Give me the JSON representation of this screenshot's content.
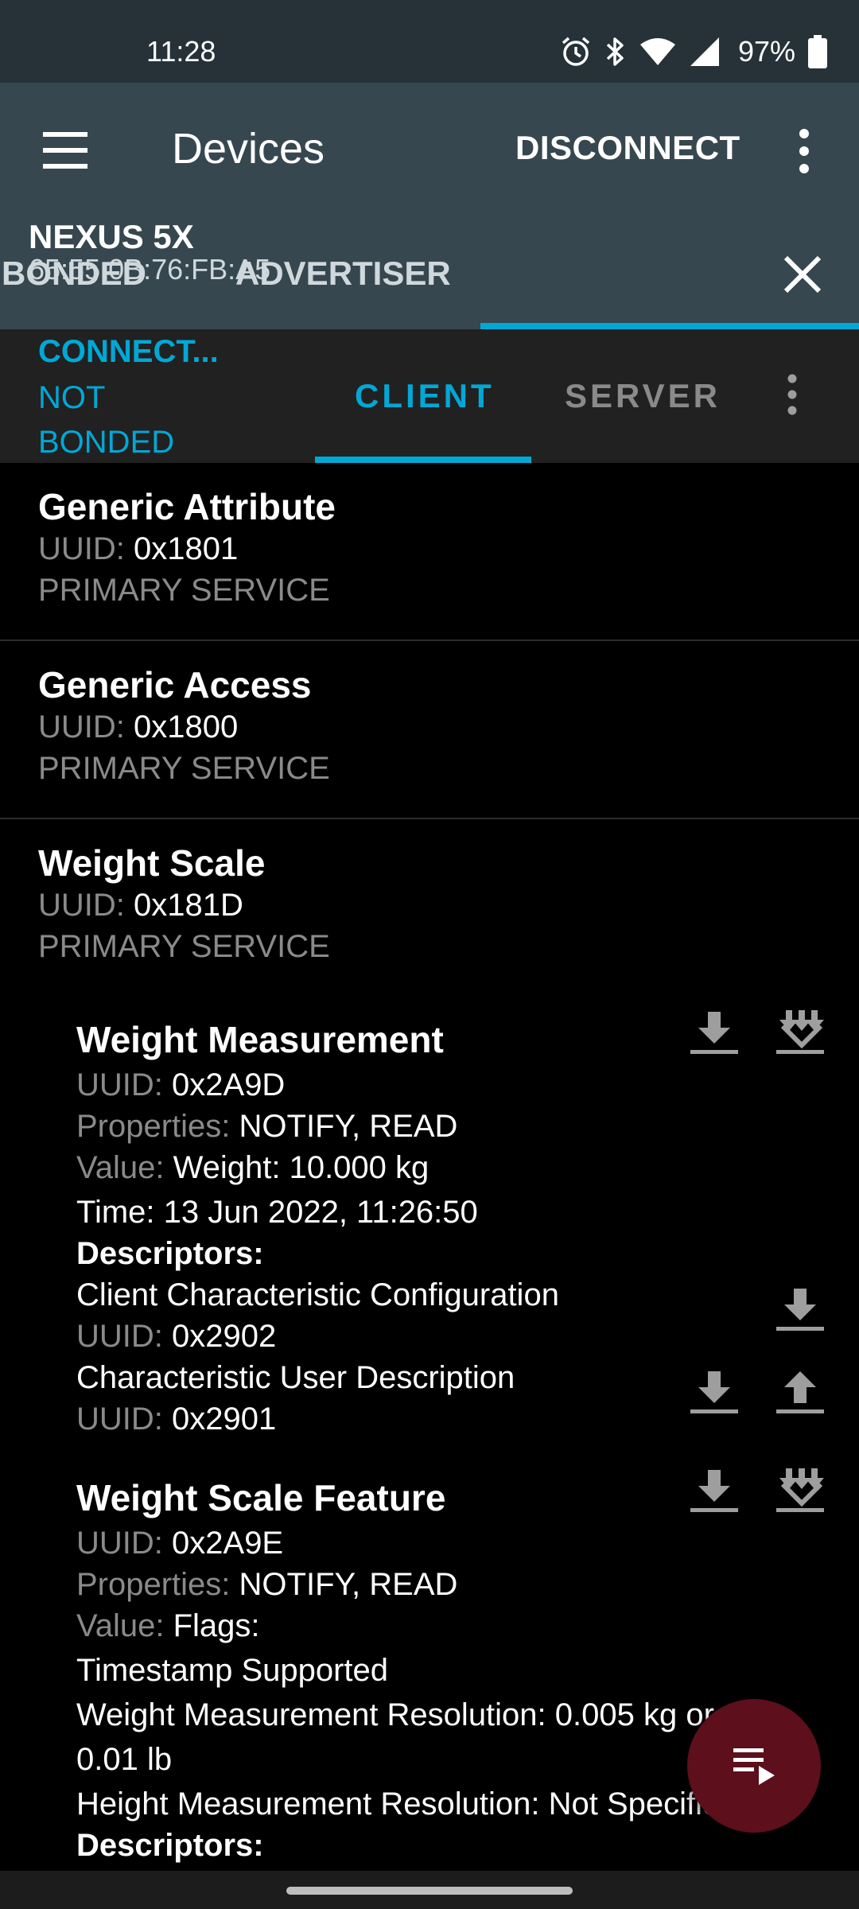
{
  "status_bar": {
    "time": "11:28",
    "battery": "97%",
    "icons": [
      "alarm-icon",
      "bluetooth-icon",
      "wifi-icon",
      "signal-icon",
      "battery-icon"
    ]
  },
  "app_bar": {
    "title": "Devices",
    "disconnect_label": "DISCONNECT"
  },
  "device_tabs": {
    "bonded": "BONDED",
    "advertiser": "ADVERTISER",
    "device_name": "NEXUS 5X",
    "device_address": "65:55:0B:76:FB:A5"
  },
  "connection": {
    "state": "CONNECT...",
    "bond_state": "NOT BONDED",
    "tab_client": "CLIENT",
    "tab_server": "SERVER"
  },
  "labels": {
    "uuid": "UUID:",
    "properties": "Properties:",
    "value": "Value:",
    "descriptors": "Descriptors:"
  },
  "services": [
    {
      "name": "Generic Attribute",
      "uuid": "0x1801",
      "type": "PRIMARY SERVICE"
    },
    {
      "name": "Generic Access",
      "uuid": "0x1800",
      "type": "PRIMARY SERVICE"
    },
    {
      "name": "Weight Scale",
      "uuid": "0x181D",
      "type": "PRIMARY SERVICE"
    }
  ],
  "characteristics": [
    {
      "name": "Weight Measurement",
      "uuid": "0x2A9D",
      "properties": "NOTIFY, READ",
      "value_lines": [
        "Weight: 10.000 kg",
        "Time: 13 Jun 2022, 11:26:50"
      ],
      "descriptors": [
        {
          "name": "Client Characteristic Configuration",
          "uuid": "0x2902"
        },
        {
          "name": "Characteristic User Description",
          "uuid": "0x2901"
        }
      ]
    },
    {
      "name": "Weight Scale Feature",
      "uuid": "0x2A9E",
      "properties": "NOTIFY, READ",
      "value_lines": [
        "Flags:",
        "Timestamp Supported",
        "Weight Measurement Resolution: 0.005 kg or",
        "0.01 lb",
        "Height Measurement Resolution: Not Specified"
      ]
    }
  ],
  "colors": {
    "status_bar": "#263238",
    "app_bar": "#37474f",
    "accent": "#00a8d6",
    "fab": "#5d0f1c"
  }
}
